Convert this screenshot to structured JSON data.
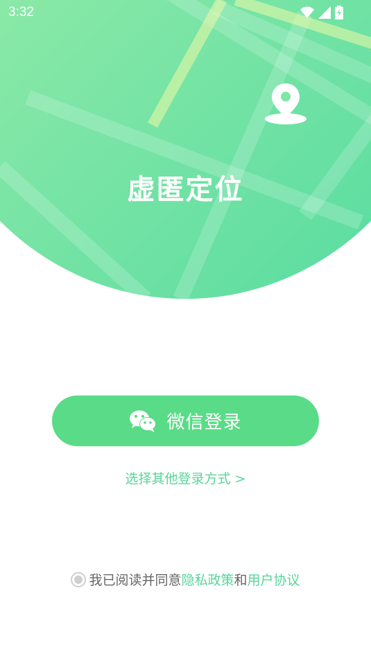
{
  "status_bar": {
    "time": "3:32",
    "icons": [
      "wifi-icon",
      "signal-icon",
      "battery-charging-icon"
    ]
  },
  "hero": {
    "title": "虚匿定位",
    "icon": "location-pin-icon"
  },
  "login": {
    "wechat_label": "微信登录",
    "wechat_icon": "wechat-icon",
    "other_methods": "选择其他登录方式 >"
  },
  "agreement": {
    "prefix": "我已阅读并同意",
    "privacy_link": "隐私政策",
    "conjunction": "和",
    "terms_link": "用户协议"
  },
  "colors": {
    "brand_green": "#5adb87",
    "link_green": "#58d59a",
    "hero_gradient_start": "#a6f0a8",
    "hero_gradient_end": "#55dba0"
  }
}
